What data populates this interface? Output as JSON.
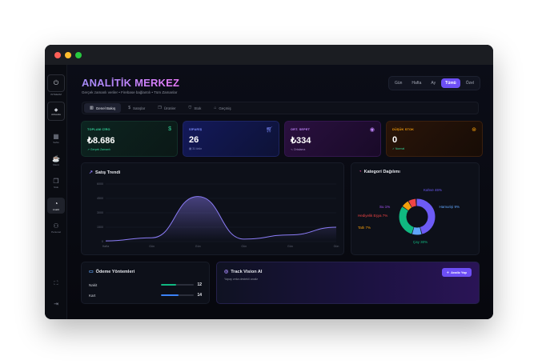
{
  "sidebar": {
    "logo_label": "INTHEAM",
    "brand_label": "Arkvants",
    "items": [
      {
        "label": "Sahis",
        "icon": "grid-icon"
      },
      {
        "label": "Menü",
        "icon": "coffee-icon"
      },
      {
        "label": "Stok",
        "icon": "box-icon"
      },
      {
        "label": "Analiz",
        "icon": "pie-chart-icon"
      },
      {
        "label": "Personel",
        "icon": "users-icon"
      }
    ],
    "fullscreen_icon": "fullscreen-icon",
    "logout_icon": "logout-icon"
  },
  "header": {
    "title": "ANALİTİK MERKEZ",
    "subtitle": "Gerçek zamanlı veriler • Firebase bağlantılı • Tüm Zamanlar"
  },
  "range": [
    "Gün",
    "Hafta",
    "Ay",
    "Tümü",
    "Özel"
  ],
  "range_active": "Tümü",
  "tabs": [
    {
      "label": "Genel Bakış",
      "icon": "chart-icon"
    },
    {
      "label": "Satışlar",
      "icon": "dollar-icon"
    },
    {
      "label": "Ürünler",
      "icon": "box-icon"
    },
    {
      "label": "Stok",
      "icon": "cart-icon"
    },
    {
      "label": "Geçmiş",
      "icon": "tag-icon"
    }
  ],
  "tabs_active": "Genel Bakış",
  "kpis": [
    {
      "label": "TOPLAM CİRO",
      "value": "₺8.686",
      "sub": "↗ Gerçek Zamanlı",
      "icon": "dollar-icon"
    },
    {
      "label": "SİPARİŞ",
      "value": "26",
      "sub": "▤ 31 ürün",
      "icon": "cart-icon"
    },
    {
      "label": "ORT. SEPET",
      "value": "₺334",
      "sub": "∿ Ortalama",
      "icon": "target-icon"
    },
    {
      "label": "DÜŞÜK STOK",
      "value": "0",
      "sub": "✓ Normal",
      "icon": "alert-icon"
    }
  ],
  "trend": {
    "title": "Satış Trendi",
    "icon": "trend-icon"
  },
  "category": {
    "title": "Kategori Dağılımı",
    "icon": "pie-icon"
  },
  "payments": {
    "title": "Ödeme Yöntemleri",
    "icon": "card-icon",
    "rows": [
      {
        "name": "Nakit",
        "count": "12",
        "fraction": 0.46,
        "color": "#10b981"
      },
      {
        "name": "Kart",
        "count": "14",
        "fraction": 0.54,
        "color": "#3b82f6"
      }
    ]
  },
  "ai": {
    "title": "Track Vision AI",
    "subtitle": "Yapay zeka destekli analiz",
    "button": "Analiz Yap",
    "icon": "spark-icon"
  },
  "chart_data": [
    {
      "type": "area",
      "title": "Satış Trendi",
      "x": [
        "Hafta",
        "Gün",
        "Gün",
        "Gün",
        "Gün",
        "Gün"
      ],
      "y_ticks": [
        "6000",
        "4500",
        "3000",
        "1500",
        "0"
      ],
      "ylim": [
        0,
        6000
      ],
      "values": [
        70,
        400,
        4700,
        260,
        700,
        1500
      ],
      "color": "#8b7cf6"
    },
    {
      "type": "pie",
      "title": "Kategori Dağılımı",
      "slices": [
        {
          "label": "Kahve 46%",
          "value": 46,
          "color": "#6d5bf6"
        },
        {
          "label": "Hamurişi 9%",
          "value": 9,
          "color": "#60a5fa"
        },
        {
          "label": "Çay 30%",
          "value": 30,
          "color": "#10b981"
        },
        {
          "label": "Tatlı 7%",
          "value": 7,
          "color": "#f59e0b"
        },
        {
          "label": "Hediyelik Eşya 7%",
          "value": 7,
          "color": "#ef4444"
        },
        {
          "label": "Su 1%",
          "value": 1,
          "color": "#a855f7"
        }
      ]
    }
  ]
}
